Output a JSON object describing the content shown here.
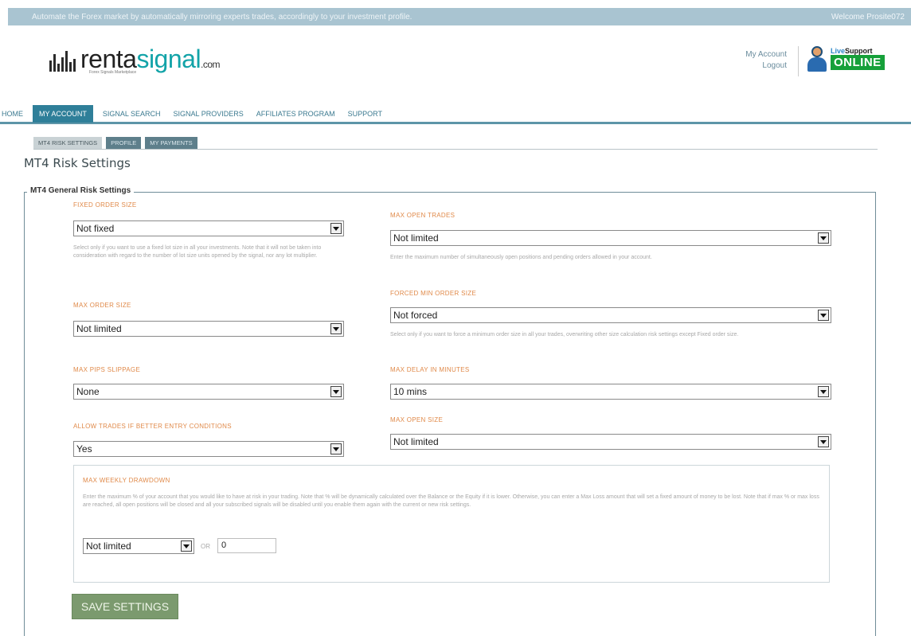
{
  "topbar": {
    "tagline": "Automate the Forex market by automatically mirroring experts trades, accordingly to your investment profile.",
    "welcome": "Welcome Prosite072"
  },
  "header": {
    "logo_prefix": "renta",
    "logo_signal": "signal",
    "logo_suffix": ".com",
    "logo_tagline": "Forex Signals Marketplace",
    "account_link": "My Account",
    "logout_link": "Logout",
    "live_support_label_prefix": "Live",
    "live_support_label_suffix": "Support",
    "live_support_status": "ONLINE"
  },
  "nav": {
    "items": [
      {
        "label": "HOME"
      },
      {
        "label": "MY ACCOUNT"
      },
      {
        "label": "SIGNAL SEARCH"
      },
      {
        "label": "SIGNAL PROVIDERS"
      },
      {
        "label": "AFFILIATES PROGRAM"
      },
      {
        "label": "SUPPORT"
      }
    ]
  },
  "subnav": {
    "tabs": [
      {
        "label": "MT4 RISK SETTINGS"
      },
      {
        "label": "PROFILE"
      },
      {
        "label": "MY PAYMENTS"
      }
    ]
  },
  "page_title": "MT4 Risk Settings",
  "group_legend": "MT4 General Risk Settings",
  "fields": {
    "fixed_order_size": {
      "label": "FIXED ORDER SIZE",
      "value": "Not fixed",
      "help": "Select only if you want to use a fixed lot size in all your investments. Note that it will not be taken into consideration with regard to the number of lot size units opened by the signal, nor any lot multiplier."
    },
    "max_open_trades": {
      "label": "MAX OPEN TRADES",
      "value": "Not limited",
      "help": "Enter the maximum number of simultaneously open positions and pending orders allowed in your account."
    },
    "max_order_size": {
      "label": "MAX ORDER SIZE",
      "value": "Not limited"
    },
    "forced_min_order_size": {
      "label": "FORCED MIN ORDER SIZE",
      "value": "Not forced",
      "help": "Select only if you want to force a minimum order size in all your trades, overwriting other size calculation risk settings except Fixed order size."
    },
    "max_pips_slippage": {
      "label": "MAX PIPS SLIPPAGE",
      "value": "None"
    },
    "max_delay_minutes": {
      "label": "MAX DELAY IN MINUTES",
      "value": "10 mins"
    },
    "allow_better_entry": {
      "label": "ALLOW TRADES IF BETTER ENTRY CONDITIONS",
      "value": "Yes"
    },
    "max_open_size": {
      "label": "MAX OPEN SIZE",
      "value": "Not limited"
    },
    "max_weekly_drawdown": {
      "label": "MAX WEEKLY DRAWDOWN",
      "help": "Enter the maximum % of your account that you would like to have at risk in your trading. Note that % will be dynamically calculated over the Balance or the Equity if it is lower. Otherwise, you can enter a Max Loss amount that will set a fixed amount of money to be lost. Note that if max % or max loss are reached, all open positions will be closed and all your subscribed signals will be disabled until you enable them again with the current or new risk settings.",
      "select_value": "Not limited",
      "or_label": "OR",
      "amount_value": "0"
    }
  },
  "save_button": "SAVE SETTINGS",
  "colors": {
    "accent": "#2f7f99",
    "label_orange": "#e08a4a",
    "topbar": "#a9c4d1",
    "save_green": "#7b9a6e",
    "online_green": "#16a03a"
  }
}
